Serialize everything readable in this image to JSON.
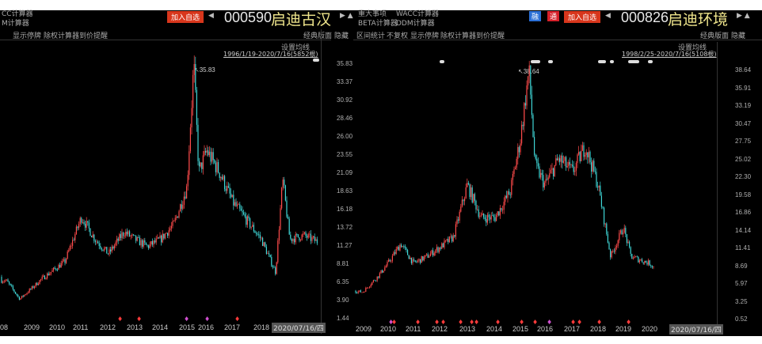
{
  "left": {
    "toolbar_top": [
      "CC计算器",
      "M计算器"
    ],
    "add_watch": "加入自选",
    "code": "000590",
    "name": "启迪古汉",
    "tools": [
      "显示停牌",
      "除权计算器",
      "到价提醒"
    ],
    "classic": "经典版面",
    "hide": "隐藏",
    "set_ma": "设置均线",
    "range": "1996/1/19-2020/7/16(5852根)",
    "high_label": "35.83",
    "date_box": "2020/07/16/四",
    "years": [
      "08",
      "2009",
      "2010",
      "2011",
      "2012",
      "2013",
      "2014",
      "2015",
      "2016",
      "2017",
      "2018"
    ]
  },
  "right": {
    "toolbar_top": [
      "重大事项",
      "WACC计算器",
      "BETA计算器",
      "DDM计算器"
    ],
    "badge_rong": "融",
    "badge_tong": "通",
    "add_watch": "加入自选",
    "code": "000826",
    "name": "启迪环境",
    "tools": [
      "区间统计",
      "不复权",
      "显示停牌",
      "除权计算器",
      "到价提醒"
    ],
    "classic": "经典版面",
    "hide": "隐藏",
    "left_hide": "隐藏",
    "set_ma": "设置均线",
    "range": "1998/2/25-2020/7/16(5108根)",
    "high_label": "38.64",
    "date_box": "2020/07/16/四",
    "years": [
      "2009",
      "2010",
      "2011",
      "2012",
      "2013",
      "2014",
      "2015",
      "2016",
      "2017",
      "2018",
      "2019",
      "2020"
    ],
    "left_axis": [
      "35.83",
      "33.37",
      "30.92",
      "28.46",
      "26.00",
      "23.55",
      "21.09",
      "18.63",
      "16.18",
      "13.72",
      "11.27",
      "8.81",
      "6.35",
      "3.90",
      "1.44"
    ],
    "right_axis": [
      "38.64",
      "35.91",
      "33.19",
      "30.47",
      "27.75",
      "25.02",
      "22.30",
      "19.58",
      "16.86",
      "14.14",
      "11.41",
      "8.69",
      "5.97",
      "3.25",
      "0.52"
    ]
  },
  "chart_data": [
    {
      "type": "candlestick",
      "title": "000590 启迪古汉",
      "ylim": [
        1.44,
        35.83
      ],
      "high": 35.83,
      "points": [
        [
          2007.9,
          6.9
        ],
        [
          2008.5,
          3.9
        ],
        [
          2009.3,
          6.5
        ],
        [
          2010.3,
          9
        ],
        [
          2011,
          15
        ],
        [
          2011.5,
          12
        ],
        [
          2012,
          10
        ],
        [
          2012.6,
          13
        ],
        [
          2013,
          12
        ],
        [
          2013.5,
          11
        ],
        [
          2014,
          12
        ],
        [
          2014.5,
          14
        ],
        [
          2015,
          19
        ],
        [
          2015.35,
          35.8
        ],
        [
          2015.6,
          21
        ],
        [
          2016,
          24
        ],
        [
          2016.5,
          21
        ],
        [
          2017,
          17
        ],
        [
          2017.6,
          14
        ],
        [
          2018,
          12
        ],
        [
          2018.5,
          7.5
        ],
        [
          2018.75,
          20
        ],
        [
          2019,
          12
        ],
        [
          2019.5,
          12.5
        ],
        [
          2020.5,
          10.7
        ]
      ]
    },
    {
      "type": "candlestick",
      "title": "000826 启迪环境",
      "ylim": [
        0.52,
        38.64
      ],
      "high": 38.64,
      "points": [
        [
          2008.6,
          4.8
        ],
        [
          2009,
          4.6
        ],
        [
          2009.6,
          7
        ],
        [
          2010,
          9
        ],
        [
          2010.5,
          12
        ],
        [
          2011,
          9
        ],
        [
          2011.5,
          10
        ],
        [
          2012,
          11.4
        ],
        [
          2012.5,
          13
        ],
        [
          2013,
          21
        ],
        [
          2013.5,
          16
        ],
        [
          2014,
          16
        ],
        [
          2014.6,
          20
        ],
        [
          2015,
          28
        ],
        [
          2015.35,
          38.6
        ],
        [
          2015.6,
          24
        ],
        [
          2016,
          21
        ],
        [
          2016.5,
          25
        ],
        [
          2017,
          23
        ],
        [
          2017.5,
          27
        ],
        [
          2018,
          21
        ],
        [
          2018.5,
          10
        ],
        [
          2019,
          14.5
        ],
        [
          2019.3,
          10
        ],
        [
          2020,
          9
        ],
        [
          2020.3,
          8
        ]
      ]
    }
  ]
}
